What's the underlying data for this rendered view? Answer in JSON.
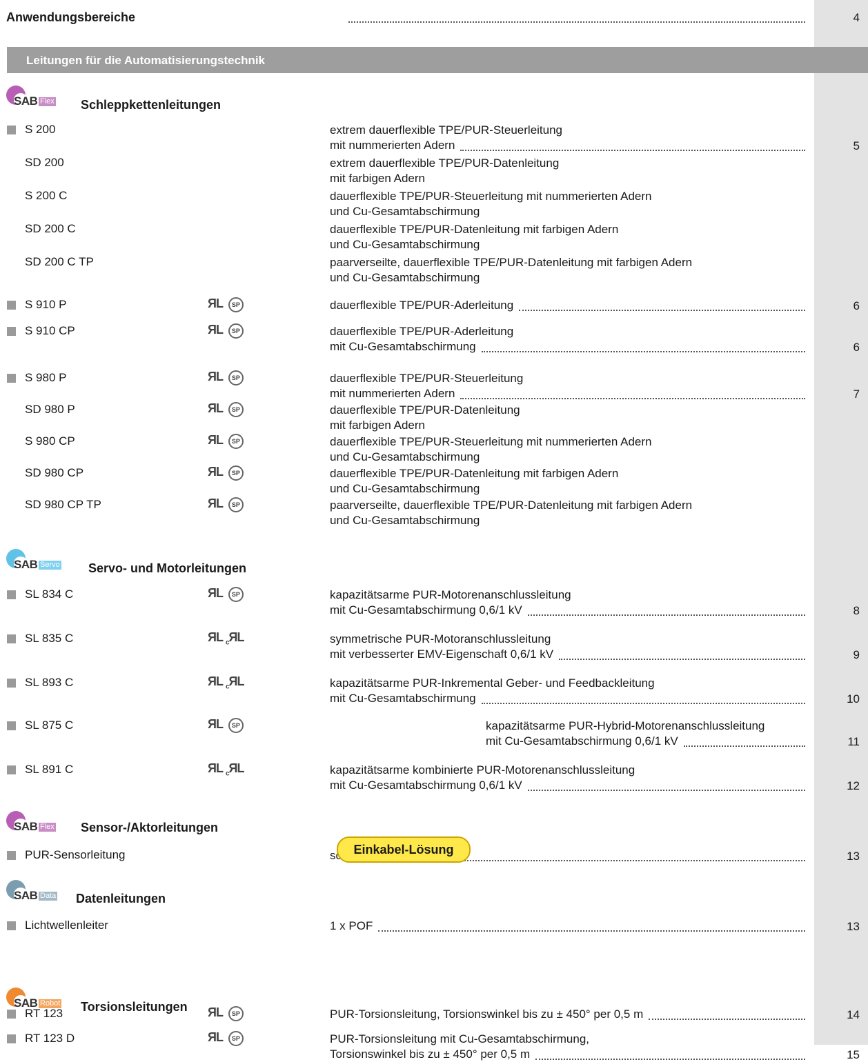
{
  "top": {
    "title": "Anwendungsbereiche",
    "page": "4"
  },
  "section_title": "Leitungen für die Automatisierungstechnik",
  "categories": {
    "schlepp": {
      "logo_text": "SAB",
      "logo_sub": "Flex",
      "title": "Schleppkettenleitungen",
      "color": "#b85fb5",
      "sub_bg": "#c98cc6"
    },
    "servo": {
      "logo_text": "SAB",
      "logo_sub": "Servo",
      "title": "Servo- und Motorleitungen",
      "color": "#5fc2e6",
      "sub_bg": "#7fd0ee"
    },
    "sensor": {
      "logo_text": "SAB",
      "logo_sub": "Flex",
      "title": "Sensor-/Aktorleitungen",
      "color": "#b85fb5",
      "sub_bg": "#c98cc6"
    },
    "daten": {
      "logo_text": "SAB",
      "logo_sub": "Data",
      "title": "Datenleitungen",
      "color": "#7a9eaf",
      "sub_bg": "#a3bac6"
    },
    "torsion": {
      "logo_text": "SAB",
      "logo_sub": "Robot",
      "title": "Torsionsleitungen",
      "color": "#f08a30",
      "sub_bg": "#f3a55e"
    }
  },
  "cert_labels": {
    "ul": "ЯL",
    "csa": "SP",
    "cul": "c"
  },
  "rows": [
    {
      "code": "S 200",
      "l1": "extrem dauerflexible TPE/PUR-Steuerleitung",
      "l2": "mit nummerierten Adern",
      "page": "5"
    },
    {
      "code": "SD 200",
      "l1": "extrem dauerflexible TPE/PUR-Datenleitung",
      "l2": "mit farbigen Adern",
      "page": ""
    },
    {
      "code": "S 200 C",
      "l1": "dauerflexible TPE/PUR-Steuerleitung mit nummerierten Adern",
      "l2": "und Cu-Gesamtabschirmung",
      "page": ""
    },
    {
      "code": "SD 200 C",
      "l1": "dauerflexible TPE/PUR-Datenleitung mit farbigen Adern",
      "l2": "und Cu-Gesamtabschirmung",
      "page": ""
    },
    {
      "code": "SD 200 C TP",
      "l1": "paarverseilte, dauerflexible TPE/PUR-Datenleitung mit farbigen Adern",
      "l2": "und Cu-Gesamtabschirmung",
      "page": ""
    },
    {
      "code": "S 910 P",
      "l1": "dauerflexible TPE/PUR-Aderleitung",
      "l2": "",
      "page": "6"
    },
    {
      "code": "S 910 CP",
      "l1": "dauerflexible TPE/PUR-Aderleitung",
      "l2": "mit Cu-Gesamtabschirmung",
      "page": "6"
    },
    {
      "code": "S 980 P",
      "l1": "dauerflexible TPE/PUR-Steuerleitung",
      "l2": "mit nummerierten Adern",
      "page": "7"
    },
    {
      "code": "SD 980 P",
      "l1": "dauerflexible TPE/PUR-Datenleitung",
      "l2": "mit farbigen Adern",
      "page": ""
    },
    {
      "code": "S 980 CP",
      "l1": "dauerflexible TPE/PUR-Steuerleitung mit nummerierten Adern",
      "l2": "und Cu-Gesamtabschirmung",
      "page": ""
    },
    {
      "code": "SD 980 CP",
      "l1": "dauerflexible TPE/PUR-Datenleitung mit farbigen Adern",
      "l2": "und Cu-Gesamtabschirmung",
      "page": ""
    },
    {
      "code": "SD 980 CP TP",
      "l1": "paarverseilte, dauerflexible TPE/PUR-Datenleitung mit farbigen Adern",
      "l2": "und Cu-Gesamtabschirmung",
      "page": ""
    },
    {
      "code": "SL 834 C",
      "l1": "kapazitätsarme PUR-Motorenanschlussleitung",
      "l2": "mit Cu-Gesamtabschirmung 0,6/1 kV",
      "page": "8"
    },
    {
      "code": "SL 835 C",
      "l1": "symmetrische PUR-Motoranschlussleitung",
      "l2": "mit verbesserter EMV-Eigenschaft 0,6/1 kV",
      "page": "9"
    },
    {
      "code": "SL 893 C",
      "l1": "kapazitätsarme PUR-Inkremental Geber- und Feedbackleitung",
      "l2": "mit Cu-Gesamtabschirmung",
      "page": "10"
    },
    {
      "code": "SL 875 C",
      "l1": "kapazitätsarme PUR-Hybrid-Motorenanschlussleitung",
      "l2": "mit Cu-Gesamtabschirmung 0,6/1 kV",
      "page": "11",
      "badge": "Einkabel-Lösung"
    },
    {
      "code": "SL 891 C",
      "l1": "kapazitätsarme kombinierte PUR-Motorenanschlussleitung",
      "l2": "mit Cu-Gesamtabschirmung 0,6/1 kV",
      "page": "12"
    },
    {
      "code": "PUR-Sensorleitung",
      "l1": "schleppkettenfähig",
      "l2": "",
      "page": "13"
    },
    {
      "code": "Lichtwellenleiter",
      "l1": "1 x POF",
      "l2": "",
      "page": "13"
    },
    {
      "code": "RT 123",
      "l1": "PUR-Torsionsleitung, Torsionswinkel bis zu ± 450° per 0,5 m",
      "l2": "",
      "page": "14"
    },
    {
      "code": "RT 123 D",
      "l1": "PUR-Torsionsleitung mit Cu-Gesamtabschirmung,",
      "l2": "Torsionswinkel bis zu ± 450° per 0,5 m",
      "page": "15"
    }
  ]
}
